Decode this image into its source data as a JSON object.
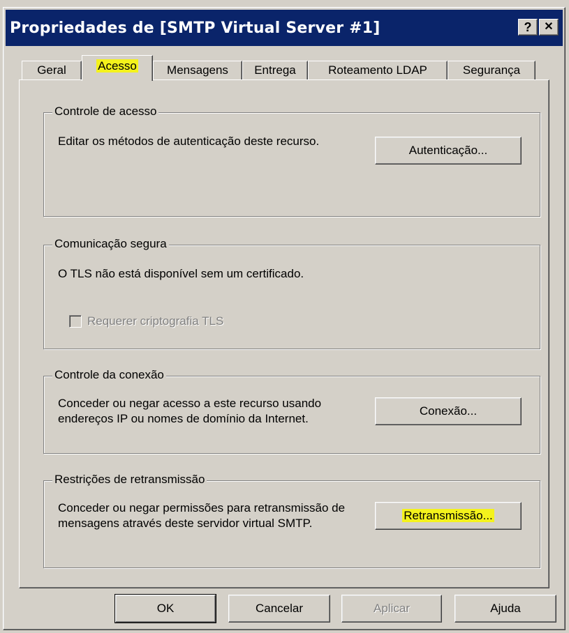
{
  "window": {
    "title": "Propriedades de [SMTP Virtual Server #1]",
    "help_button": "?",
    "close_button": "✕"
  },
  "tabs": [
    {
      "label": "Geral"
    },
    {
      "label": "Acesso"
    },
    {
      "label": "Mensagens"
    },
    {
      "label": "Entrega"
    },
    {
      "label": "Roteamento LDAP"
    },
    {
      "label": "Segurança"
    }
  ],
  "groups": {
    "access_control": {
      "legend": "Controle de acesso",
      "text": "Editar os métodos de autenticação deste recurso.",
      "button": "Autenticação..."
    },
    "secure_comm": {
      "legend": "Comunicação segura",
      "text": "O TLS não está disponível sem um certificado.",
      "checkbox_label": "Requerer criptografia TLS"
    },
    "connection_control": {
      "legend": "Controle da conexão",
      "text": "Conceder ou negar acesso a este recurso usando endereços IP ou nomes de domínio da Internet.",
      "button": "Conexão..."
    },
    "relay_restrictions": {
      "legend": "Restrições de retransmissão",
      "text": "Conceder ou negar permissões para retransmissão de mensagens através deste servidor virtual SMTP.",
      "button": "Retransmissão..."
    }
  },
  "footer": {
    "ok": "OK",
    "cancel": "Cancelar",
    "apply": "Aplicar",
    "help": "Ajuda"
  },
  "colors": {
    "titlebar": "#0a246a",
    "face": "#d4d0c8",
    "highlight_marker": "#f4f21c"
  }
}
